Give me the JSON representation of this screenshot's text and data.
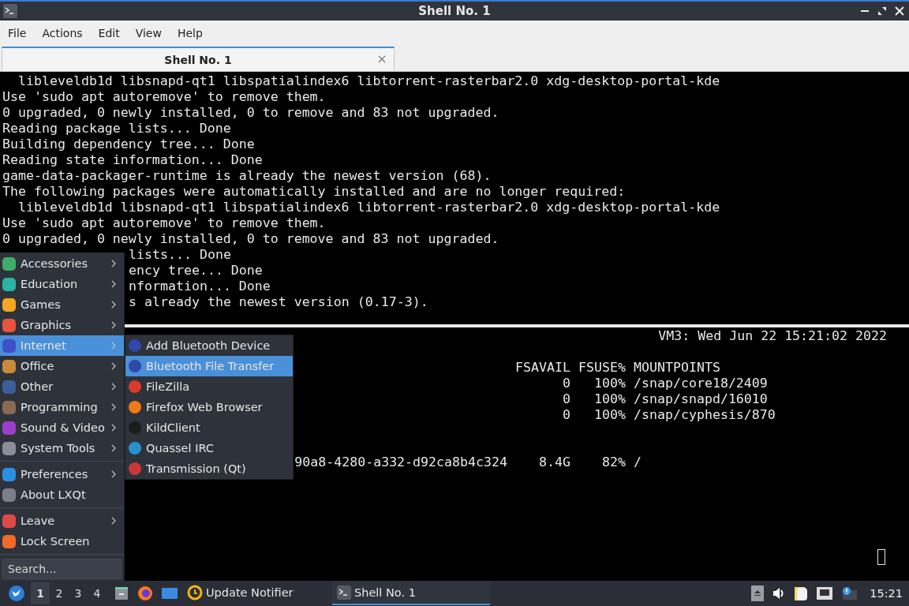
{
  "window": {
    "title": "Shell No. 1"
  },
  "menubar": [
    "File",
    "Actions",
    "Edit",
    "View",
    "Help"
  ],
  "tabs": [
    {
      "label": "Shell No. 1",
      "selected": true
    }
  ],
  "terminal": {
    "upper_lines": [
      {
        "text": "  libleveldb1d libsnapd-qt1 libspatialindex6 libtorrent-rasterbar2.0 xdg-desktop-portal-kde",
        "kind": "full"
      },
      {
        "text": "Use 'sudo apt autoremove' to remove them.",
        "kind": "full"
      },
      {
        "text": "0 upgraded, 0 newly installed, 0 to remove and 83 not upgraded.",
        "kind": "full"
      },
      {
        "text": "Reading package lists... Done",
        "kind": "full"
      },
      {
        "text": "Building dependency tree... Done",
        "kind": "full"
      },
      {
        "text": "Reading state information... Done",
        "kind": "full"
      },
      {
        "text": "game-data-packager-runtime is already the newest version (68).",
        "kind": "full"
      },
      {
        "text": "The following packages were automatically installed and are no longer required:",
        "kind": "full"
      },
      {
        "text": "  libleveldb1d libsnapd-qt1 libspatialindex6 libtorrent-rasterbar2.0 xdg-desktop-portal-kde",
        "kind": "full"
      },
      {
        "text": "Use 'sudo apt autoremove' to remove them.",
        "kind": "full"
      },
      {
        "text": "0 upgraded, 0 newly installed, 0 to remove and 83 not upgraded.",
        "kind": "full"
      },
      {
        "text": "lists... Done",
        "kind": "covered"
      },
      {
        "text": "ency tree... Done",
        "kind": "covered"
      },
      {
        "text": "nformation... Done",
        "kind": "covered"
      },
      {
        "text": "s already the newest version (0.17-3).",
        "kind": "covered"
      }
    ],
    "status_line": "VM3: Wed Jun 22 15:21:02 2022",
    "disk_table": {
      "columns": [
        "FSAVAIL",
        "FSUSE%",
        "MOUNTPOINTS"
      ],
      "rows": [
        [
          "0",
          "100%",
          "/snap/core18/2409"
        ],
        [
          "0",
          "100%",
          "/snap/snapd/16010"
        ],
        [
          "0",
          "100%",
          "/snap/cyphesis/870"
        ]
      ]
    },
    "disk_tail_row": [
      "90a8-4280-a332-d92ca8b4c324",
      "8.4G",
      "82%",
      "/"
    ]
  },
  "app_menu": {
    "groups": [
      [
        {
          "label": "Accessories",
          "selected": false,
          "has_submenu": true,
          "color": "#3fae6a"
        },
        {
          "label": "Education",
          "selected": false,
          "has_submenu": true,
          "color": "#2bb3a3"
        },
        {
          "label": "Games",
          "selected": false,
          "has_submenu": true,
          "color": "#f5a623"
        },
        {
          "label": "Graphics",
          "selected": false,
          "has_submenu": true,
          "color": "#e8553e"
        },
        {
          "label": "Internet",
          "selected": true,
          "has_submenu": true,
          "color": "#3f51c8"
        },
        {
          "label": "Office",
          "selected": false,
          "has_submenu": true,
          "color": "#c98a3a"
        },
        {
          "label": "Other",
          "selected": false,
          "has_submenu": true,
          "color": "#3c5f9a"
        },
        {
          "label": "Programming",
          "selected": false,
          "has_submenu": true,
          "color": "#8a6a55"
        },
        {
          "label": "Sound & Video",
          "selected": false,
          "has_submenu": true,
          "color": "#9b3fc8"
        },
        {
          "label": "System Tools",
          "selected": false,
          "has_submenu": true,
          "color": "#8a8f99"
        }
      ],
      [
        {
          "label": "Preferences",
          "selected": false,
          "has_submenu": true,
          "color": "#2d8fe0"
        },
        {
          "label": "About LXQt",
          "selected": false,
          "has_submenu": false,
          "color": "#7a7f88"
        }
      ],
      [
        {
          "label": "Leave",
          "selected": false,
          "has_submenu": true,
          "color": "#e04848"
        },
        {
          "label": "Lock Screen",
          "selected": false,
          "has_submenu": false,
          "color": "#f06a2a"
        }
      ]
    ],
    "search": {
      "placeholder": "Search..."
    }
  },
  "submenu": [
    {
      "label": "Add Bluetooth Device",
      "selected": false,
      "color": "#3048a8"
    },
    {
      "label": "Bluetooth File Transfer",
      "selected": true,
      "color": "#3048a8"
    },
    {
      "label": "FileZilla",
      "selected": false,
      "color": "#d93a2e"
    },
    {
      "label": "Firefox Web Browser",
      "selected": false,
      "color": "#f07a1a"
    },
    {
      "label": "KildClient",
      "selected": false,
      "color": "#1c1c1c"
    },
    {
      "label": "Quassel IRC",
      "selected": false,
      "color": "#2a8fd0"
    },
    {
      "label": "Transmission (Qt)",
      "selected": false,
      "color": "#c8383a"
    }
  ],
  "taskbar": {
    "desktops": [
      {
        "label": "1",
        "selected": true
      },
      {
        "label": "2",
        "selected": false
      },
      {
        "label": "3",
        "selected": false
      },
      {
        "label": "4",
        "selected": false
      }
    ],
    "tasks": [
      {
        "label": "Update Notifier",
        "selected": false
      },
      {
        "label": "Shell No. 1",
        "selected": true
      }
    ],
    "clock": "15:21"
  }
}
